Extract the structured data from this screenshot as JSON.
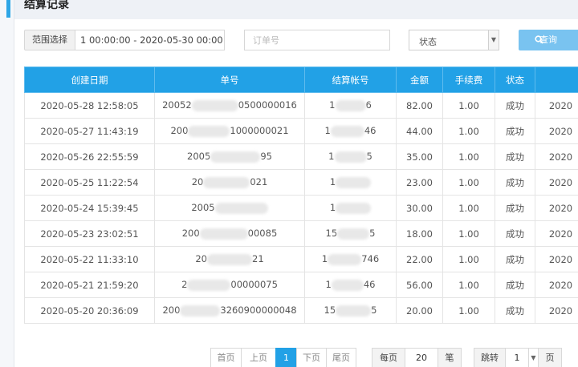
{
  "page": {
    "title": "结算记录"
  },
  "filters": {
    "range_label": "范围选择",
    "range_value": "1 00:00:00 - 2020-05-30 00:00:00",
    "order_placeholder": "订单号",
    "status_value": "状态",
    "query_label": "查询"
  },
  "table": {
    "headers": [
      "创建日期",
      "单号",
      "结算帐号",
      "金额",
      "手续费",
      "状态",
      ""
    ],
    "rows": [
      {
        "date": "2020-05-28 12:58:05",
        "order_a": "20052",
        "order_b": "0500000016",
        "acct_a": "1",
        "acct_b": "6",
        "amount": "82.00",
        "fee": "1.00",
        "status": "成功",
        "extra": "2020"
      },
      {
        "date": "2020-05-27 11:43:19",
        "order_a": "200",
        "order_b": "1000000021",
        "acct_a": "1",
        "acct_b": "46",
        "amount": "44.00",
        "fee": "1.00",
        "status": "成功",
        "extra": "2020"
      },
      {
        "date": "2020-05-26 22:55:59",
        "order_a": "2005",
        "order_b": "95",
        "acct_a": "1",
        "acct_b": "5",
        "amount": "35.00",
        "fee": "1.00",
        "status": "成功",
        "extra": "2020"
      },
      {
        "date": "2020-05-25 11:22:54",
        "order_a": "20",
        "order_b": "021",
        "acct_a": "1",
        "acct_b": "",
        "amount": "23.00",
        "fee": "1.00",
        "status": "成功",
        "extra": "2020"
      },
      {
        "date": "2020-05-24 15:39:45",
        "order_a": "2005",
        "order_b": "",
        "acct_a": "1",
        "acct_b": "",
        "amount": "30.00",
        "fee": "1.00",
        "status": "成功",
        "extra": "2020"
      },
      {
        "date": "2020-05-23 23:02:51",
        "order_a": "200",
        "order_b": "00085",
        "acct_a": "15",
        "acct_b": "5",
        "amount": "18.00",
        "fee": "1.00",
        "status": "成功",
        "extra": "2020"
      },
      {
        "date": "2020-05-22 11:33:10",
        "order_a": "20",
        "order_b": "21",
        "acct_a": "1",
        "acct_b": "746",
        "amount": "22.00",
        "fee": "1.00",
        "status": "成功",
        "extra": "2020"
      },
      {
        "date": "2020-05-21 21:59:20",
        "order_a": "2",
        "order_b": "00000075",
        "acct_a": "1",
        "acct_b": "46",
        "amount": "56.00",
        "fee": "1.00",
        "status": "成功",
        "extra": "2020"
      },
      {
        "date": "2020-05-20 20:36:09",
        "order_a": "200",
        "order_b": "3260900000048",
        "acct_a": "15",
        "acct_b": "5",
        "amount": "20.00",
        "fee": "1.00",
        "status": "成功",
        "extra": "2020"
      }
    ]
  },
  "pagination": {
    "first": "首页",
    "prev": "上页",
    "current": "1",
    "next": "下页",
    "last": "尾页",
    "per_page_label": "每页",
    "per_page_value": "20",
    "per_page_unit": "笔",
    "jump_label": "跳转",
    "jump_value": "1",
    "page_unit": "页"
  },
  "colors": {
    "accent": "#22a1e6",
    "query_button": "#79c3f0"
  }
}
